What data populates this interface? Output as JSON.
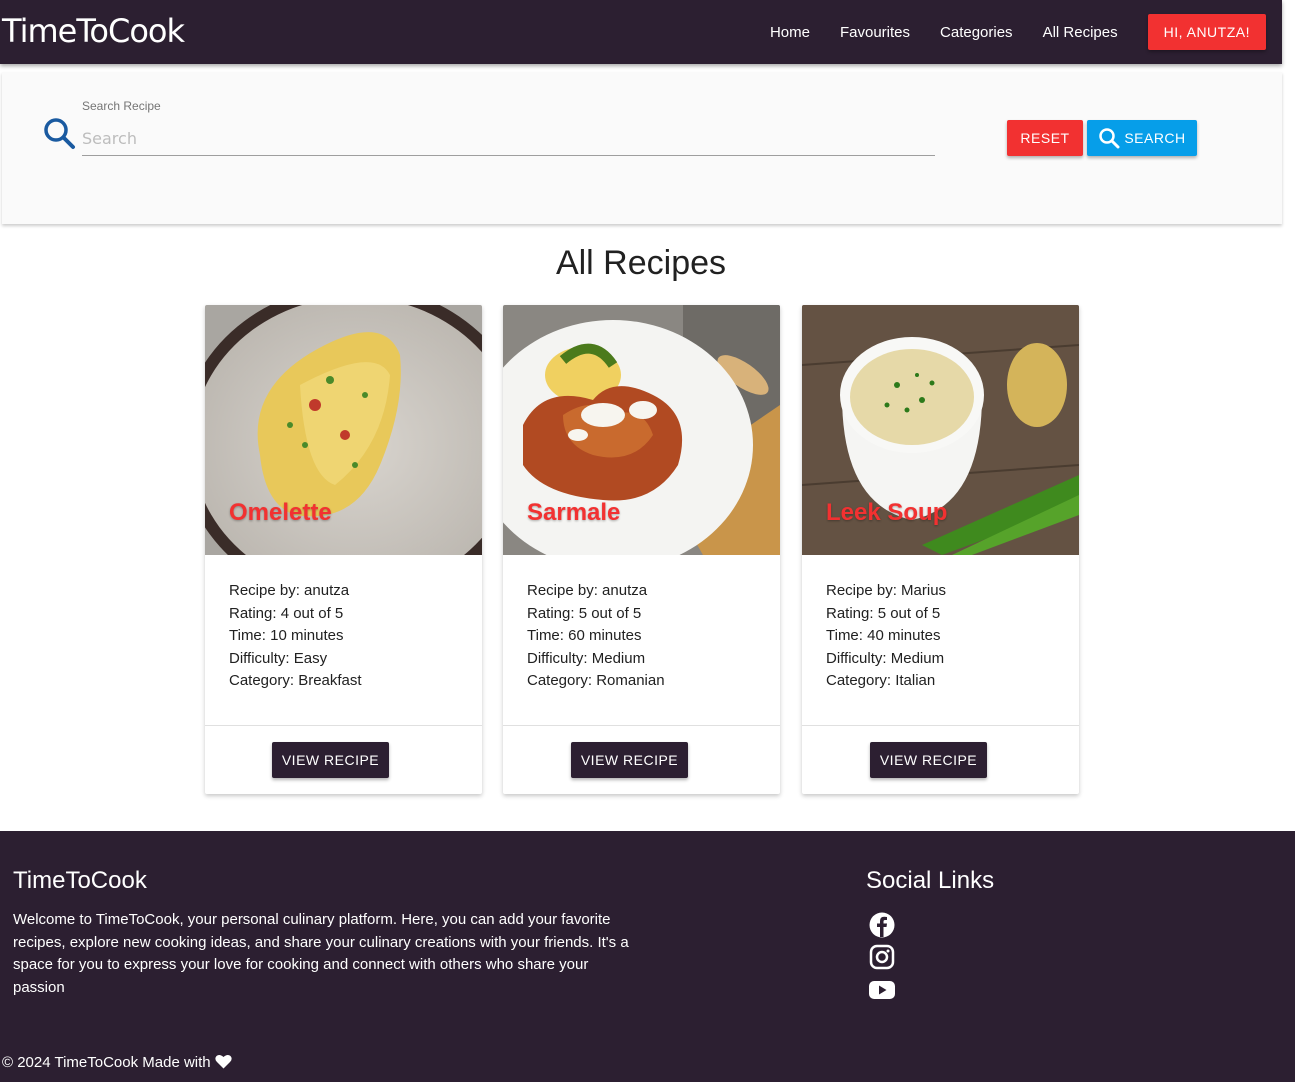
{
  "navbar": {
    "brand": "TimeToCook",
    "links": [
      "Home",
      "Favourites",
      "Categories",
      "All Recipes"
    ],
    "user_button": "HI, ANUTZA!"
  },
  "search": {
    "label": "Search Recipe",
    "placeholder": "Search",
    "value": "",
    "reset_label": "RESET",
    "search_label": "SEARCH"
  },
  "main": {
    "title": "All Recipes",
    "recipes": [
      {
        "name": "Omelette",
        "recipe_by": "Recipe by: anutza",
        "rating": "Rating: 4 out of 5",
        "time": "Time: 10 minutes",
        "difficulty": "Difficulty: Easy",
        "category": "Category: Breakfast",
        "button": "VIEW RECIPE"
      },
      {
        "name": "Sarmale",
        "recipe_by": "Recipe by: anutza",
        "rating": "Rating: 5 out of 5",
        "time": "Time: 60 minutes",
        "difficulty": "Difficulty: Medium",
        "category": "Category: Romanian",
        "button": "VIEW RECIPE"
      },
      {
        "name": "Leek Soup",
        "recipe_by": "Recipe by: Marius",
        "rating": "Rating: 5 out of 5",
        "time": "Time: 40 minutes",
        "difficulty": "Difficulty: Medium",
        "category": "Category: Italian",
        "button": "VIEW RECIPE"
      }
    ]
  },
  "footer": {
    "title": "TimeToCook",
    "description": "Welcome to TimeToCook, your personal culinary platform. Here, you can add your favorite recipes, explore new cooking ideas, and share your culinary creations with your friends. It's a space for you to express your love for cooking and connect with others who share your passion",
    "social_title": "Social Links",
    "social_icons": [
      "facebook-icon",
      "instagram-icon",
      "youtube-icon"
    ],
    "copyright": "© 2024 TimeToCook Made with"
  },
  "colors": {
    "primary_dark": "#2c1f31",
    "accent_red": "#f23131",
    "accent_blue": "#069ee9",
    "search_icon": "#1a5aa0"
  }
}
